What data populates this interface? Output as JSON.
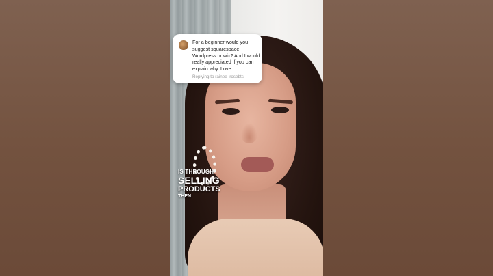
{
  "question_card": {
    "text": "For a beginner would you suggest squarespace, Wordpress or wix? And I would really appreciated if you can explain why. Love",
    "reply_line": "Replying to rainee_rosebts"
  },
  "caption": {
    "line1": "IS THROUGH",
    "line2": "SELLING",
    "line3": "PRODUCTS",
    "line4": "THEN"
  }
}
